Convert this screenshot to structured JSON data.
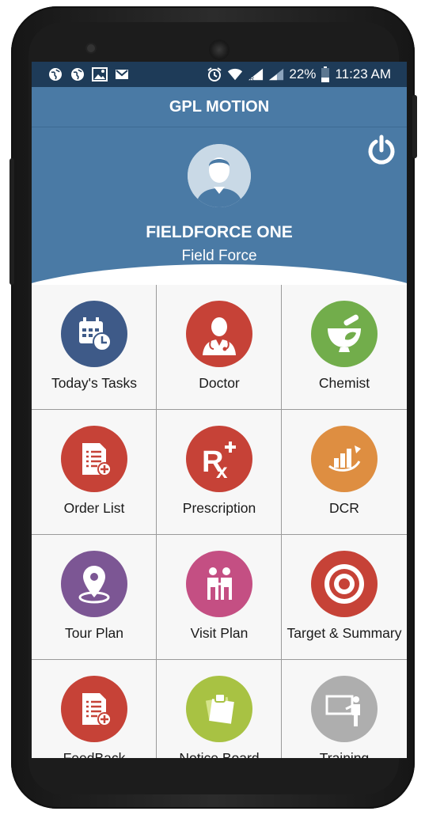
{
  "status_bar": {
    "left_icons": [
      "globe-icon",
      "globe-icon",
      "image-icon",
      "mail-icon"
    ],
    "right_icons": [
      "alarm-icon",
      "wifi-icon",
      "signal-icon",
      "signal-icon",
      "battery-icon"
    ],
    "battery": "22%",
    "time": "11:23 AM"
  },
  "app_bar": {
    "title": "GPL MOTION"
  },
  "profile": {
    "name": "FIELDFORCE ONE",
    "role": "Field Force",
    "avatar_icon": "user-avatar-icon",
    "power_icon": "power-icon"
  },
  "menu": [
    {
      "label": "Today's Tasks",
      "icon": "calendar-clock-icon",
      "color": "#3e5a88"
    },
    {
      "label": "Doctor",
      "icon": "doctor-icon",
      "color": "#c64237"
    },
    {
      "label": "Chemist",
      "icon": "mortar-pestle-icon",
      "color": "#72ad4b"
    },
    {
      "label": "Order List",
      "icon": "order-list-icon",
      "color": "#c64237"
    },
    {
      "label": "Prescription",
      "icon": "rx-icon",
      "color": "#c64237"
    },
    {
      "label": "DCR",
      "icon": "bar-chart-icon",
      "color": "#de8e41"
    },
    {
      "label": "Tour Plan",
      "icon": "map-pin-icon",
      "color": "#7c5694"
    },
    {
      "label": "Visit Plan",
      "icon": "visit-icon",
      "color": "#c44f83"
    },
    {
      "label": "Target & Summary",
      "icon": "target-icon",
      "color": "#c64237"
    },
    {
      "label": "FeedBack",
      "icon": "feedback-icon",
      "color": "#c64237"
    },
    {
      "label": "Notice Board",
      "icon": "notice-board-icon",
      "color": "#a8c243"
    },
    {
      "label": "Training",
      "icon": "training-icon",
      "color": "#aeaeae"
    }
  ]
}
